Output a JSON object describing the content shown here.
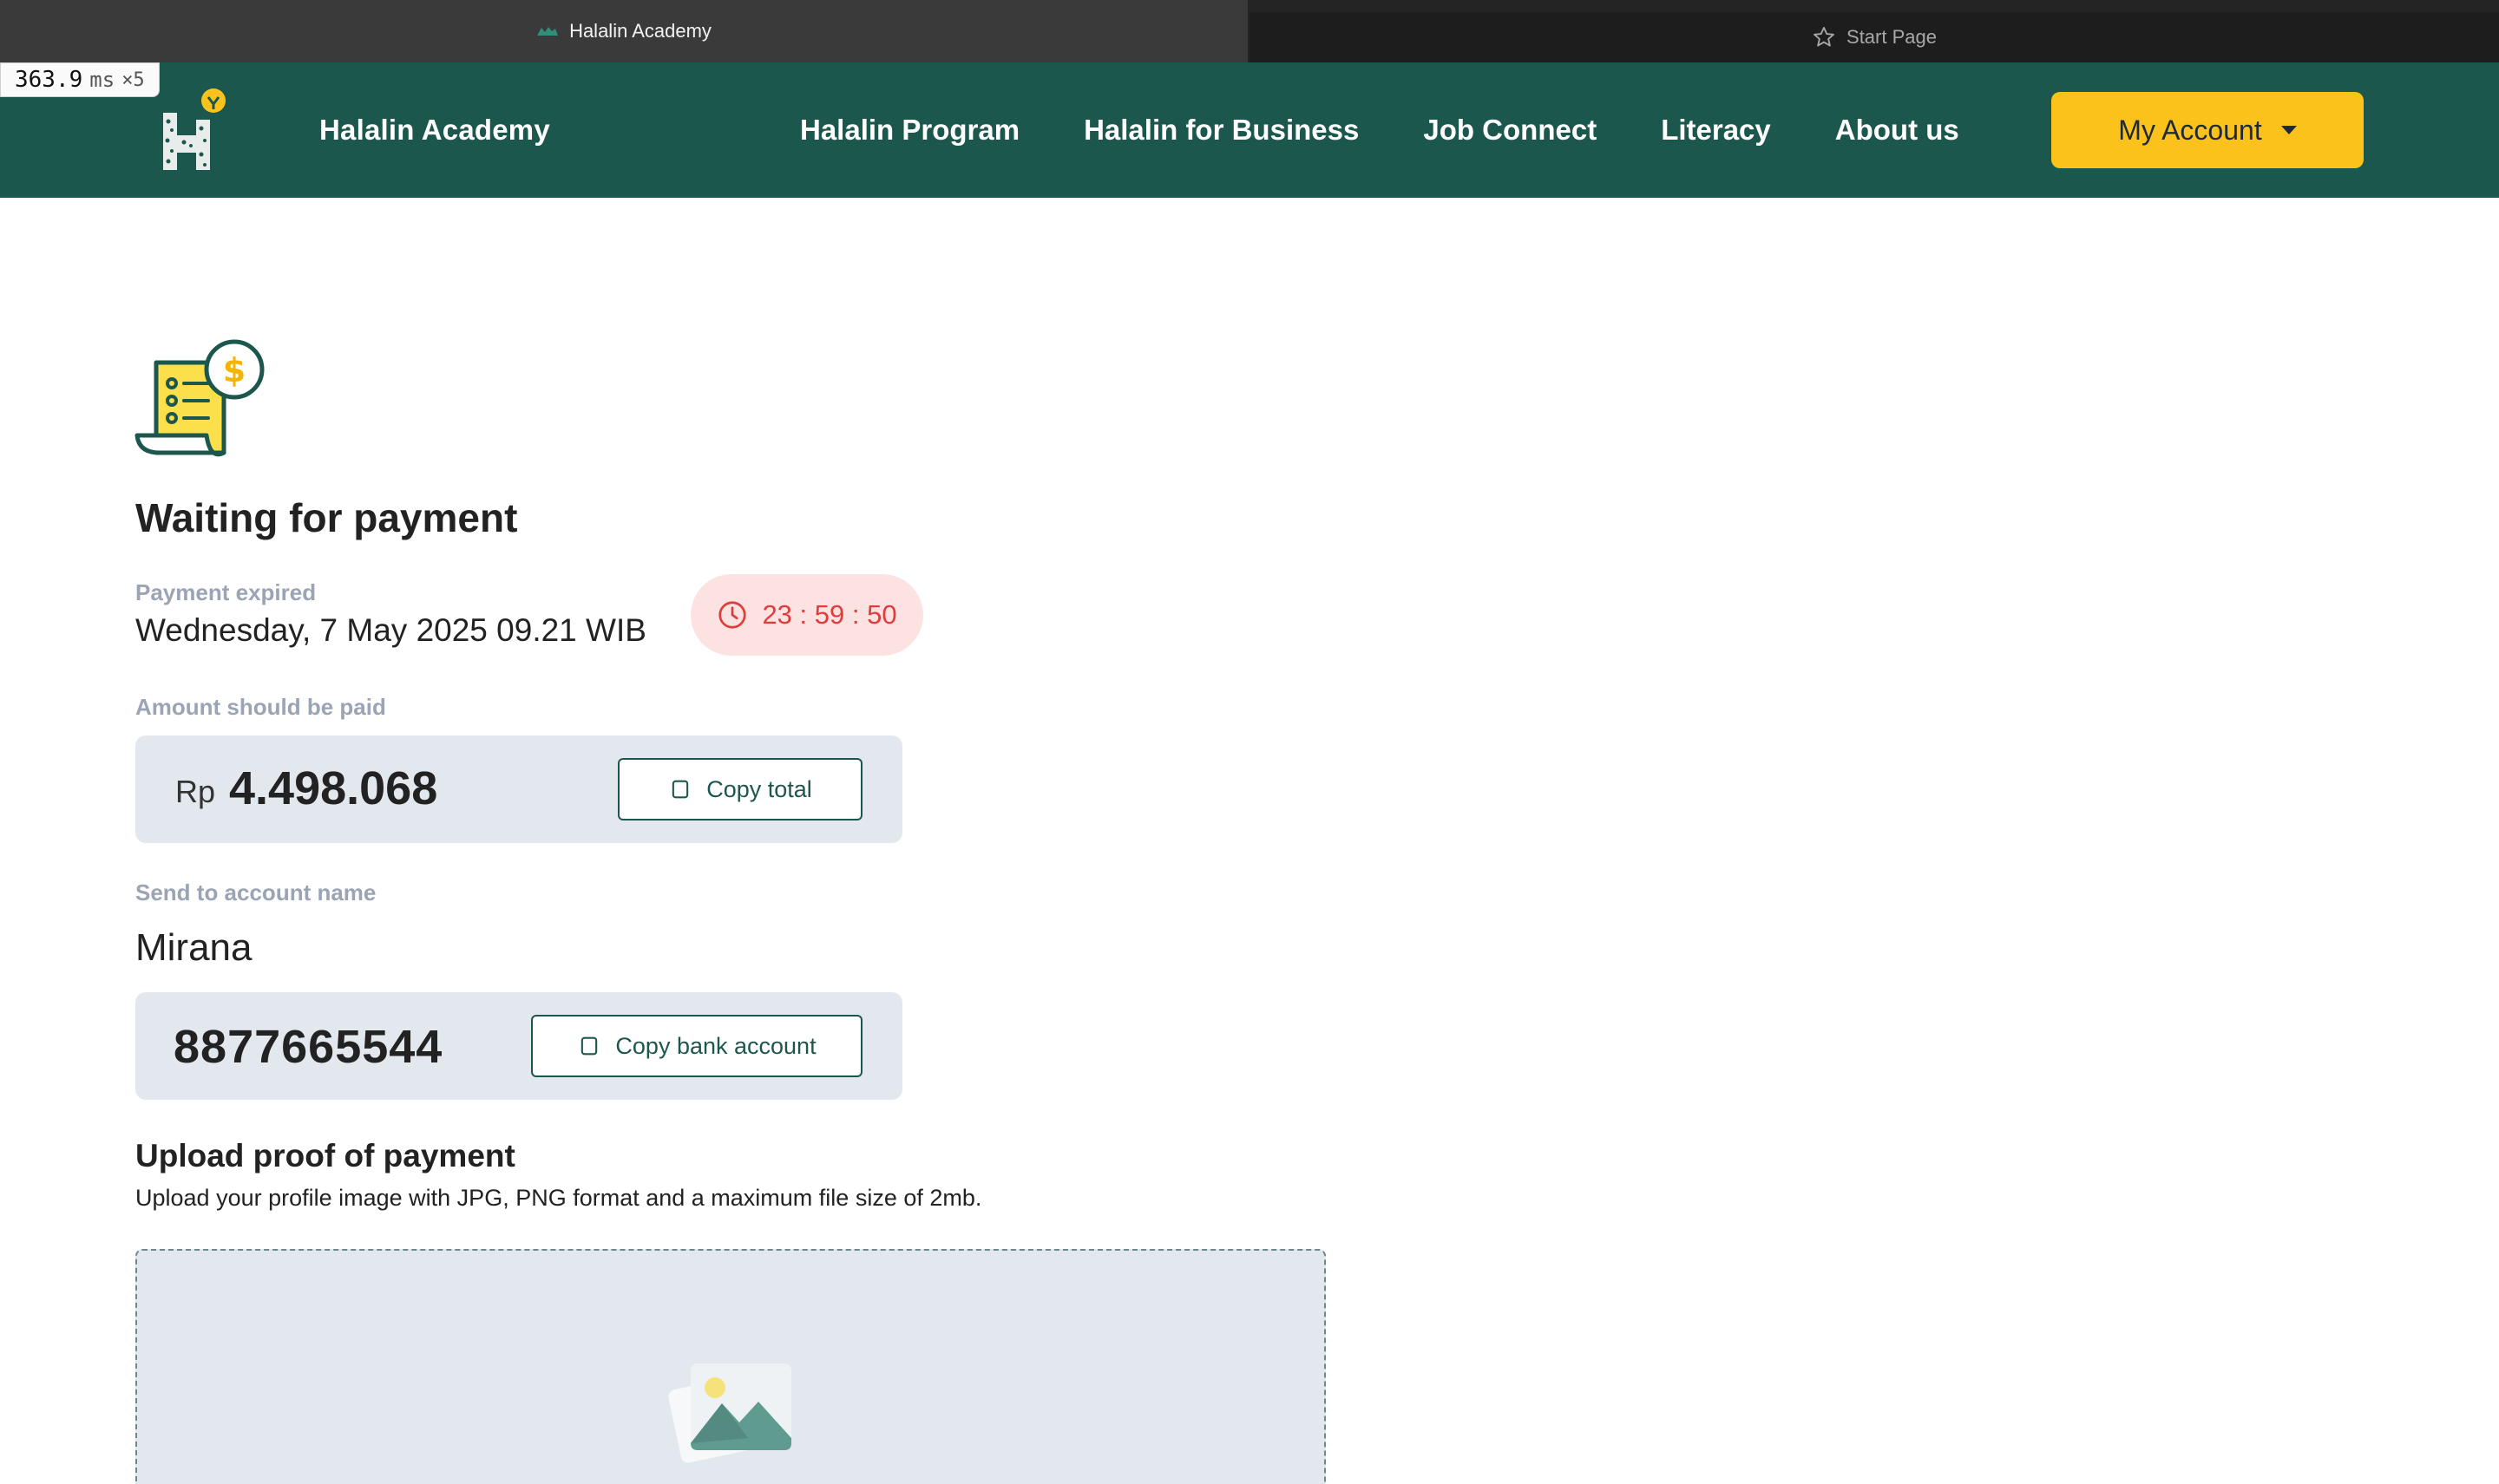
{
  "browser": {
    "active_tab": "Halalin Academy",
    "inactive_tab": "Start Page"
  },
  "perf_badge": {
    "value": "363.9",
    "unit": "ms",
    "multiplier": "×5"
  },
  "nav": {
    "brand": "Halalin Academy",
    "menu": [
      {
        "label": "Halalin Program"
      },
      {
        "label": "Halalin for Business"
      },
      {
        "label": "Job Connect"
      },
      {
        "label": "Literacy"
      },
      {
        "label": "About us"
      }
    ],
    "account_label": "My Account"
  },
  "payment": {
    "title": "Waiting for payment",
    "expired_label": "Payment expired",
    "expired_date": "Wednesday, 7 May 2025 09.21 WIB",
    "countdown": "23 : 59 : 50",
    "amount_label": "Amount should be paid",
    "currency": "Rp",
    "amount": "4.498.068",
    "copy_total_label": "Copy total",
    "send_label": "Send to account name",
    "account_name": "Mirana",
    "bank_account": "8877665544",
    "copy_bank_label": "Copy bank account"
  },
  "upload": {
    "title": "Upload proof of payment",
    "description": "Upload your profile image with JPG, PNG format and a maximum file size of 2mb."
  },
  "colors": {
    "brand_green": "#1c574d",
    "accent_yellow": "#fcc21c",
    "timer_red": "#e03c3c",
    "timer_bg": "#fde2e2",
    "panel_bg": "#e3e8ef",
    "label_grey": "#9aa4b4"
  },
  "icons": [
    "favicon-icon",
    "star-icon",
    "halalin-logo",
    "bill-icon",
    "clock-icon",
    "copy-icon",
    "image-placeholder-icon",
    "caret-down-icon"
  ]
}
